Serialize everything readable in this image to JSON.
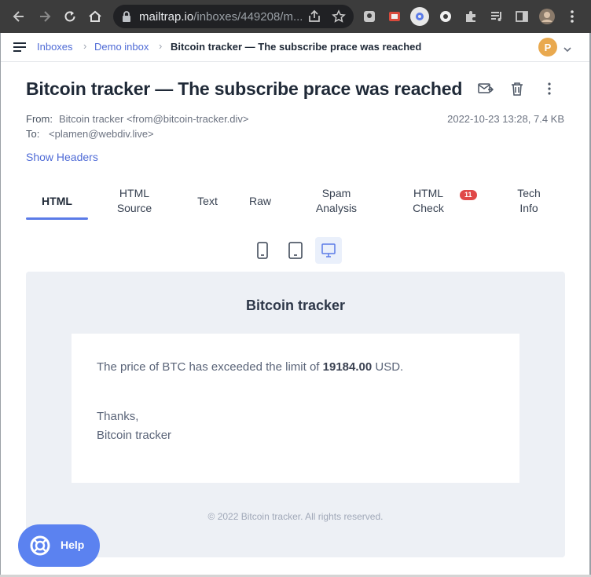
{
  "browser": {
    "url_host": "mailtrap.io",
    "url_path": "/inboxes/449208/m..."
  },
  "breadcrumb": {
    "items": [
      "Inboxes",
      "Demo inbox"
    ],
    "current": "Bitcoin tracker — The subscribe prace was reached"
  },
  "user": {
    "avatar_letter": "P"
  },
  "message": {
    "subject": "Bitcoin tracker — The subscribe prace was reached",
    "from_label": "From:",
    "from_value": "Bitcoin tracker <from@bitcoin-tracker.div>",
    "to_label": "To:",
    "to_value": "<plamen@webdiv.live>",
    "date_size": "2022-10-23 13:28, 7.4 KB",
    "show_headers": "Show Headers"
  },
  "tabs": {
    "html": "HTML",
    "html_source": "HTML\nSource",
    "text": "Text",
    "raw": "Raw",
    "spam": "Spam\nAnalysis",
    "html_check": "HTML\nCheck",
    "html_check_badge": "11",
    "tech": "Tech\nInfo"
  },
  "preview": {
    "title": "Bitcoin tracker",
    "line1_pre": "The price of BTC has exceeded the limit of ",
    "line1_value": "19184.00",
    "line1_post": " USD.",
    "thanks": "Thanks,",
    "signature": "Bitcoin tracker",
    "footer": "© 2022 Bitcoin tracker. All rights reserved."
  },
  "help": {
    "label": "Help"
  },
  "colors": {
    "accent": "#5b7be8",
    "link": "#4f6bd6",
    "badge": "#e04848",
    "help": "#5b82f0",
    "avatar": "#e9a94f"
  }
}
